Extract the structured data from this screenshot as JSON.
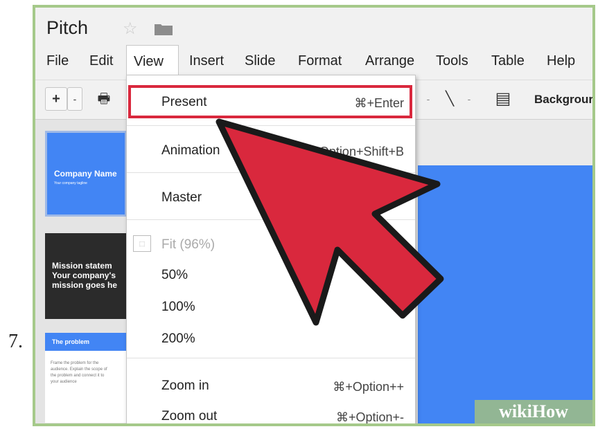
{
  "step_number": "7.",
  "app": {
    "title": "Pitch"
  },
  "menubar": {
    "items": [
      {
        "label": "File"
      },
      {
        "label": "Edit"
      },
      {
        "label": "View"
      },
      {
        "label": "Insert"
      },
      {
        "label": "Slide"
      },
      {
        "label": "Format"
      },
      {
        "label": "Arrange"
      },
      {
        "label": "Tools"
      },
      {
        "label": "Table"
      },
      {
        "label": "Help"
      }
    ]
  },
  "toolbar": {
    "add_label": "+",
    "dropdown_label": "-",
    "print_label": "🖶",
    "shape_dropdown_label": "-",
    "line_label": "╲",
    "line_dropdown_label": "-",
    "layout_label": "▤",
    "background_label": "Backgrour"
  },
  "slides": [
    {
      "title": "Company Name",
      "subtitle": "Your company tagline"
    },
    {
      "title": "Mission statem",
      "line2": "Your company's",
      "line3": "mission goes he"
    },
    {
      "title": "The problem",
      "body": "Frame the problem for the audience. Explain the scope of the problem and connect it to your audience"
    }
  ],
  "view_menu": {
    "items": [
      {
        "label": "Present",
        "shortcut": "⌘+Enter",
        "highlighted": true
      },
      {
        "label": "Animation",
        "shortcut": "⌘+Option+Shift+B"
      },
      {
        "label": "Master",
        "shortcut": ""
      },
      {
        "label": "Fit (96%)",
        "shortcut": "",
        "disabled": true
      },
      {
        "label": "50%",
        "shortcut": ""
      },
      {
        "label": "100%",
        "shortcut": ""
      },
      {
        "label": "200%",
        "shortcut": ""
      },
      {
        "label": "Zoom in",
        "shortcut": "⌘+Option++"
      },
      {
        "label": "Zoom out",
        "shortcut": "⌘+Option+-"
      }
    ]
  },
  "watermark": "wikiHow",
  "colors": {
    "highlight": "#d9283d",
    "slide_blue": "#4285f4",
    "frame": "#a5c98a"
  }
}
